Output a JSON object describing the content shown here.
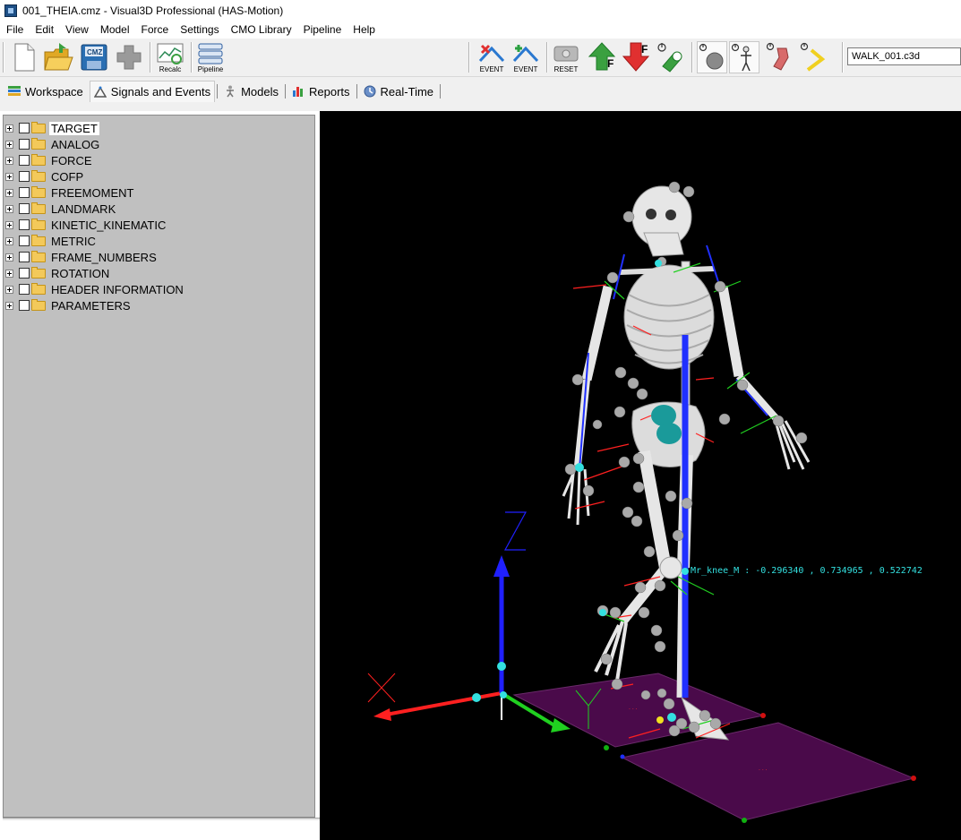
{
  "window": {
    "title": "001_THEIA.cmz - Visual3D Professional (HAS-Motion)",
    "icon": "visual3d-app-icon"
  },
  "menu": [
    "File",
    "Edit",
    "View",
    "Model",
    "Force",
    "Settings",
    "CMO Library",
    "Pipeline",
    "Help"
  ],
  "toolbar": {
    "new": "new-file-icon",
    "open": "open-folder-icon",
    "save_label": "CMZ",
    "add": "add-plus-icon",
    "recalc_label": "Recalc",
    "pipeline_label": "Pipeline",
    "event1_label": "EVENT",
    "event2_label": "EVENT",
    "reset_label": "RESET",
    "up_f_label": "F",
    "down_f_label": "F",
    "file_selector": "WALK_001.c3d"
  },
  "tabs": [
    {
      "label": "Workspace",
      "icon": "workspace-icon"
    },
    {
      "label": "Signals and Events",
      "icon": "signals-icon"
    },
    {
      "label": "Models",
      "icon": "models-icon"
    },
    {
      "label": "Reports",
      "icon": "reports-icon"
    },
    {
      "label": "Real-Time",
      "icon": "realtime-icon"
    }
  ],
  "active_tab": "Signals and Events",
  "tree": [
    {
      "label": "TARGET",
      "selected": true
    },
    {
      "label": "ANALOG"
    },
    {
      "label": "FORCE"
    },
    {
      "label": "COFP"
    },
    {
      "label": "FREEMOMENT"
    },
    {
      "label": "LANDMARK"
    },
    {
      "label": "KINETIC_KINEMATIC"
    },
    {
      "label": "METRIC"
    },
    {
      "label": "FRAME_NUMBERS"
    },
    {
      "label": "ROTATION"
    },
    {
      "label": "HEADER INFORMATION"
    },
    {
      "label": "PARAMETERS"
    }
  ],
  "viewport": {
    "readout": "Mr_knee_M : -0.296340 , 0.734965 , 0.522742",
    "axis_x_color": "#ff2020",
    "axis_y_color": "#20d020",
    "axis_z_color": "#2020ff",
    "plate_color": "#4a0a4a",
    "bone_color": "#e6e6e6",
    "marker_color": "#a9a9a9",
    "highlight_color": "#33e0e0"
  }
}
